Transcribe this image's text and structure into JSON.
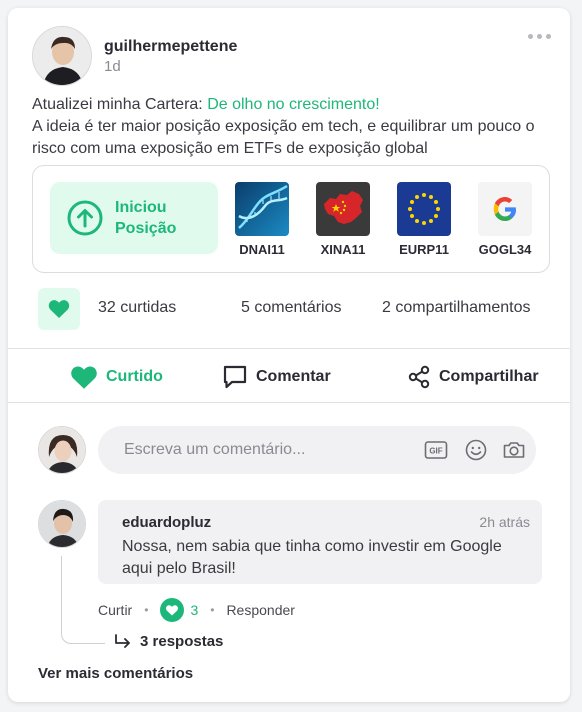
{
  "post": {
    "username": "guilhermepettene",
    "time": "1d",
    "text_prefix": "Atualizei minha Cartera: ",
    "portfolio_link": "De olho no crescimento!",
    "text_body": "A ideia é ter maior posição exposição em tech, e equilibrar um pouco o risco com uma exposição em ETFs de exposição global"
  },
  "portfolio": {
    "action_label_line1": "Iniciou",
    "action_label_line2": "Posição",
    "assets": [
      {
        "ticker": "DNAI11",
        "icon": "dna-icon"
      },
      {
        "ticker": "XINA11",
        "icon": "china-map-icon"
      },
      {
        "ticker": "EURP11",
        "icon": "eu-flag-icon"
      },
      {
        "ticker": "GOGL34",
        "icon": "google-logo-icon"
      }
    ]
  },
  "stats": {
    "likes": "32 curtidas",
    "comments": "5 comentários",
    "shares": "2 compartilhamentos"
  },
  "actions": {
    "like": "Curtido",
    "comment": "Comentar",
    "share": "Compartilhar"
  },
  "composer": {
    "placeholder": "Escreva um comentário..."
  },
  "comment": {
    "username": "eduardopluz",
    "time": "2h atrás",
    "text": "Nossa, nem sabia que tinha como investir em Google aqui pelo Brasil!",
    "like_label": "Curtir",
    "like_count": "3",
    "reply_label": "Responder",
    "replies_label": "3 respostas"
  },
  "footer": {
    "more_comments": "Ver mais comentários"
  },
  "colors": {
    "accent": "#1db879",
    "accent_light": "#e0fbee"
  }
}
